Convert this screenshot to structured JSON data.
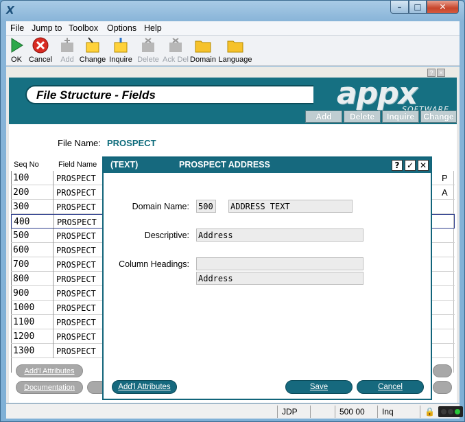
{
  "window": {
    "app_icon": "X"
  },
  "menu": [
    {
      "label": "File"
    },
    {
      "label": "Jump to"
    },
    {
      "label": "Toolbox"
    },
    {
      "label": "Options"
    },
    {
      "label": "Help"
    }
  ],
  "toolbar": [
    {
      "label": "OK",
      "icon": "ok-play-icon",
      "enabled": true
    },
    {
      "label": "Cancel",
      "icon": "cancel-x-icon",
      "enabled": true
    },
    {
      "label": "Add",
      "icon": "add-icon",
      "enabled": false
    },
    {
      "label": "Change",
      "icon": "change-icon",
      "enabled": true
    },
    {
      "label": "Inquire",
      "icon": "inquire-icon",
      "enabled": true
    },
    {
      "label": "Delete",
      "icon": "delete-icon",
      "enabled": false
    },
    {
      "label": "Ack Del",
      "icon": "ack-delete-icon",
      "enabled": false
    },
    {
      "label": "Domain",
      "icon": "folder-icon",
      "enabled": true
    },
    {
      "label": "Language",
      "icon": "folder-icon",
      "enabled": true
    }
  ],
  "header": {
    "title": "File Structure - Fields",
    "logo_text": "appx",
    "logo_sub": "SOFTWARE",
    "actions": [
      {
        "label": "Add"
      },
      {
        "label": "Delete"
      },
      {
        "label": "Inquire"
      },
      {
        "label": "Change"
      }
    ]
  },
  "file_name": {
    "label": "File Name:",
    "value": "PROSPECT"
  },
  "columns": {
    "seq": "Seq No",
    "field": "Field Name"
  },
  "rows": [
    {
      "seq": "100",
      "field": "PROSPECT",
      "flag": "P"
    },
    {
      "seq": "200",
      "field": "PROSPECT",
      "flag": "A"
    },
    {
      "seq": "300",
      "field": "PROSPECT",
      "flag": ""
    },
    {
      "seq": "400",
      "field": "PROSPECT",
      "flag": ""
    },
    {
      "seq": "500",
      "field": "PROSPECT",
      "flag": ""
    },
    {
      "seq": "600",
      "field": "PROSPECT",
      "flag": ""
    },
    {
      "seq": "700",
      "field": "PROSPECT",
      "flag": ""
    },
    {
      "seq": "800",
      "field": "PROSPECT",
      "flag": ""
    },
    {
      "seq": "900",
      "field": "PROSPECT",
      "flag": ""
    },
    {
      "seq": "1000",
      "field": "PROSPECT",
      "flag": ""
    },
    {
      "seq": "1100",
      "field": "PROSPECT",
      "flag": ""
    },
    {
      "seq": "1200",
      "field": "PROSPECT",
      "flag": ""
    },
    {
      "seq": "1300",
      "field": "PROSPECT",
      "flag": ""
    }
  ],
  "bottom_buttons": {
    "attributes": "Add'l Attributes",
    "documentation": "Documentation"
  },
  "status": {
    "user": "JDP",
    "value": "500 00",
    "mode": "Inq"
  },
  "dialog": {
    "type": "(TEXT)",
    "title": "PROSPECT ADDRESS",
    "help_icon": "?",
    "ok_icon": "✓",
    "close_icon": "✕",
    "domain_label": "Domain Name:",
    "domain_num": "500",
    "domain_name": "ADDRESS TEXT",
    "descriptive_label": "Descriptive:",
    "descriptive_value": "Address",
    "headings_label": "Column Headings:",
    "heading_line1": "",
    "heading_line2": "Address",
    "attributes_button": "Add'l Attributes",
    "save_button": "Save",
    "cancel_button": "Cancel"
  }
}
